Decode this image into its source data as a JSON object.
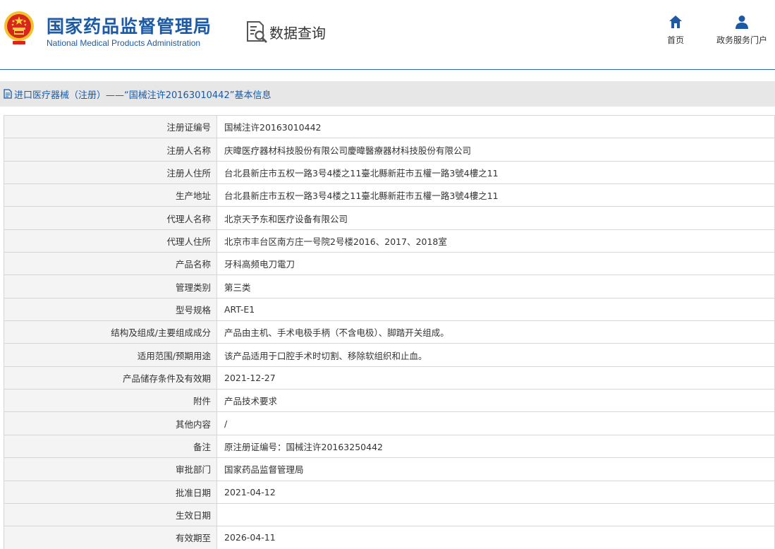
{
  "header": {
    "brand_cn": "国家药品监督管理局",
    "brand_en": "National Medical Products Administration",
    "query_label": "数据查询",
    "nav": {
      "home": "首页",
      "portal": "政务服务门户"
    }
  },
  "colors": {
    "brand_blue": "#1c5aa6",
    "title_text": "#1a5aa6",
    "titlebar_bg": "#e7e7e7",
    "key_bg": "#f4f4f4",
    "border": "#d6d6d6"
  },
  "icons": {
    "emblem": "national-emblem-icon",
    "query": "document-search-icon",
    "home": "home-icon",
    "portal": "user-icon",
    "titlebar": "document-icon"
  },
  "page_title": "进口医疗器械（注册）——“国械注许20163010442”基本信息",
  "rows": [
    {
      "key": "注册证编号",
      "value": "国械注许20163010442"
    },
    {
      "key": "注册人名称",
      "value": "庆暐医疗器材科技股份有限公司慶暐醫療器材科技股份有限公司"
    },
    {
      "key": "注册人住所",
      "value": "台北县新庄市五权一路3号4楼之11臺北縣新莊市五權一路3號4樓之11"
    },
    {
      "key": "生产地址",
      "value": "台北县新庄市五权一路3号4楼之11臺北縣新莊市五權一路3號4樓之11"
    },
    {
      "key": "代理人名称",
      "value": "北京天予东和医疗设备有限公司"
    },
    {
      "key": "代理人住所",
      "value": "北京市丰台区南方庄一号院2号楼2016、2017、2018室"
    },
    {
      "key": "产品名称",
      "value": "牙科高频电刀電刀"
    },
    {
      "key": "管理类别",
      "value": "第三类"
    },
    {
      "key": "型号规格",
      "value": "ART-E1"
    },
    {
      "key": "结构及组成/主要组成成分",
      "value": "产品由主机、手术电极手柄（不含电极）、脚踏开关组成。"
    },
    {
      "key": "适用范围/预期用途",
      "value": "该产品适用于口腔手术时切割、移除软组织和止血。"
    },
    {
      "key": "产品储存条件及有效期",
      "value": "2021-12-27"
    },
    {
      "key": "附件",
      "value": "产品技术要求"
    },
    {
      "key": "其他内容",
      "value": "/"
    },
    {
      "key": "备注",
      "value": "原注册证编号：国械注许20163250442"
    },
    {
      "key": "审批部门",
      "value": "国家药品监督管理局"
    },
    {
      "key": "批准日期",
      "value": "2021-04-12"
    },
    {
      "key": "生效日期",
      "value": ""
    },
    {
      "key": "有效期至",
      "value": "2026-04-11"
    }
  ]
}
